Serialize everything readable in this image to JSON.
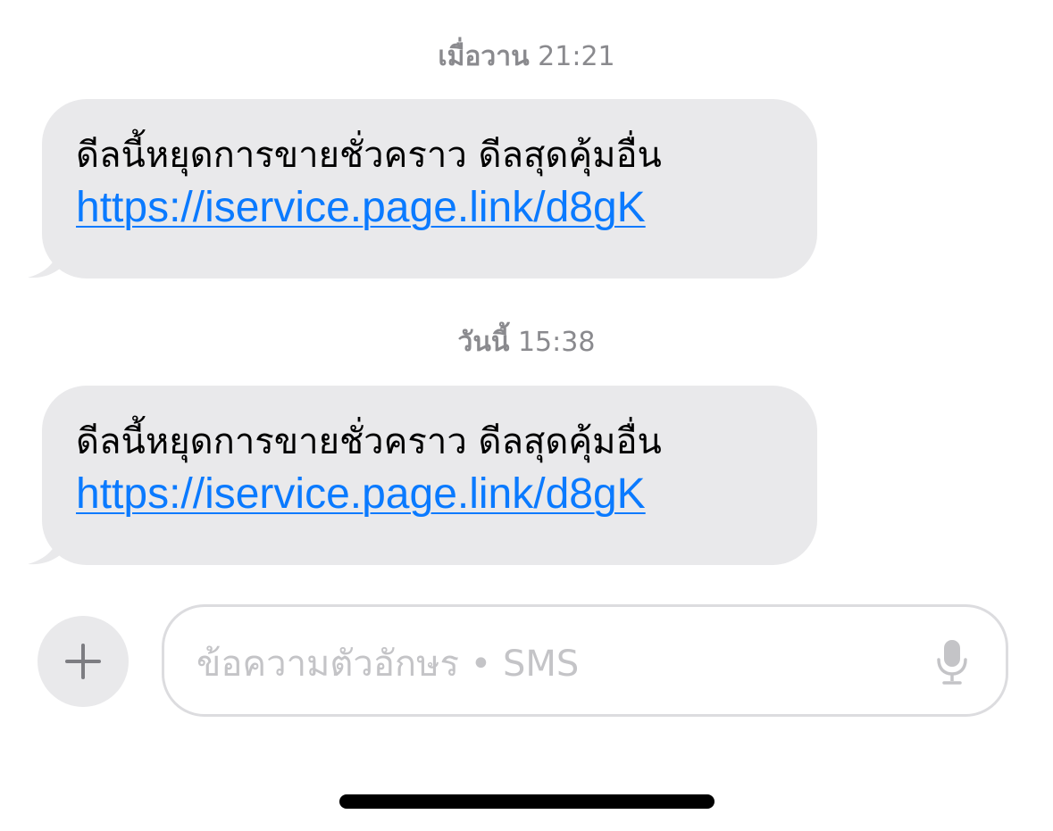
{
  "conversation": {
    "groups": [
      {
        "timestamp_day": "เมื่อวาน",
        "timestamp_time": "21:21",
        "message_text": "ดีลนี้หยุดการขายชั่วคราว ดีลสุดคุ้มอื่น",
        "message_link": "https://iservice.page.link/d8gK"
      },
      {
        "timestamp_day": "วันนี้",
        "timestamp_time": "15:38",
        "message_text": "ดีลนี้หยุดการขายชั่วคราว ดีลสุดคุ้มอื่น",
        "message_link": "https://iservice.page.link/d8gK"
      }
    ]
  },
  "composer": {
    "plus_icon": "plus-icon",
    "placeholder": "ข้อความตัวอักษร • SMS",
    "mic_icon": "microphone-icon"
  },
  "colors": {
    "incoming_bubble": "#e9e9eb",
    "link": "#0a7aff",
    "timestamp": "#8a8a8e",
    "placeholder": "#c4c4c7"
  }
}
